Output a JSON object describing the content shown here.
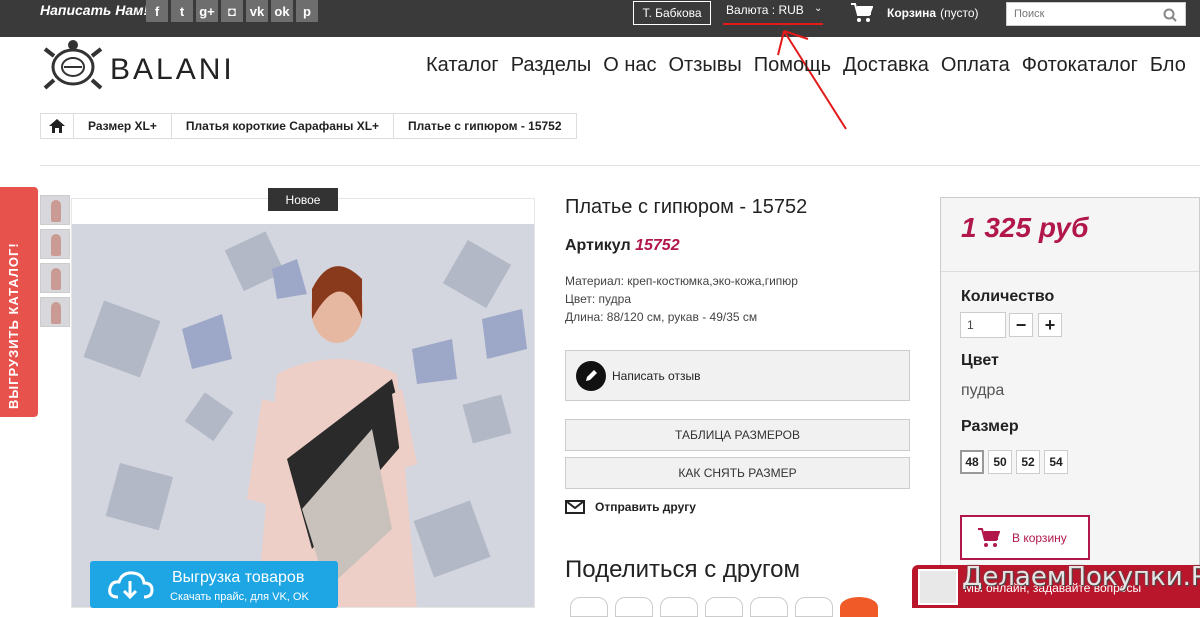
{
  "topbar": {
    "write_us": "Написать Нам!",
    "socials": [
      "facebook-icon",
      "twitter-icon",
      "google-plus-icon",
      "instagram-icon",
      "vk-icon",
      "odnoklassniki-icon",
      "pinterest-icon"
    ],
    "user": "Т. Бабкова",
    "currency": "Валюта : RUB",
    "cart_label": "Корзина",
    "cart_status": "(пусто)",
    "search_placeholder": "Поиск"
  },
  "logo": {
    "text": "BALANI"
  },
  "nav": [
    "Каталог",
    "Разделы",
    "О нас",
    "Отзывы",
    "Помощь",
    "Доставка",
    "Оплата",
    "Фотокаталог",
    "Бло"
  ],
  "breadcrumb": [
    "Размер XL+",
    "Платья короткие Сарафаны XL+",
    "Платье с гипюром - 15752"
  ],
  "side_tab": "ВЫГРУЗИТЬ КАТАЛОГ!",
  "badge": "Новое",
  "upload": {
    "title": "Выгрузка товаров",
    "subtitle": "Скачать прайс, для VK, OK"
  },
  "product": {
    "title": "Платье с гипюром - 15752",
    "article_label": "Артикул",
    "article": "15752",
    "material": "Материал: креп-костюмка,эко-кожа,гипюр",
    "color_line": "Цвет: пудра",
    "length_line": "Длина: 88/120 см, рукав - 49/35 см",
    "review_btn": "Написать отзыв",
    "size_table_btn": "ТАБЛИЦА РАЗМЕРОВ",
    "measure_btn": "КАК СНЯТЬ РАЗМЕР",
    "send_friend": "Отправить другу",
    "share_title": "Поделиться с другом"
  },
  "buybox": {
    "price": "1 325 руб",
    "qty_label": "Количество",
    "qty": "1",
    "color_label": "Цвет",
    "color_value": "пудра",
    "size_label": "Размер",
    "sizes": [
      "48",
      "50",
      "52",
      "54"
    ],
    "cart_btn": "В корзину"
  },
  "chat": {
    "text": "Мы онлайн, задавайте вопросы"
  },
  "watermark": "ДелаемПокупки.Ру",
  "colors": {
    "accent": "#b1174a",
    "topbar": "#3a3a3a",
    "side_tab": "#e8524d",
    "upload": "#1ea6e4"
  }
}
